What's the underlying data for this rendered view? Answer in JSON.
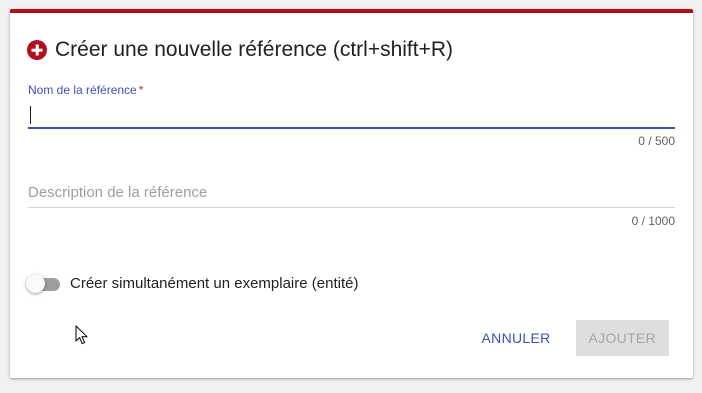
{
  "dialog": {
    "accent_color": "#b10e1e",
    "title_icon": "plus-circle-icon",
    "title": "Créer une nouvelle référence (ctrl+shift+R)"
  },
  "name_field": {
    "label": "Nom de la référence",
    "required_mark": "*",
    "value": "",
    "counter": "0 / 500",
    "active_color": "#3f51b5"
  },
  "description_field": {
    "placeholder": "Description de la référence",
    "value": "",
    "counter": "0 / 1000"
  },
  "toggle": {
    "label": "Créer simultanément un exemplaire (entité)",
    "checked": false
  },
  "actions": {
    "cancel_label": "ANNULER",
    "add_label": "AJOUTER",
    "add_disabled": true
  },
  "pointer": {
    "icon": "mouse-pointer-icon"
  }
}
